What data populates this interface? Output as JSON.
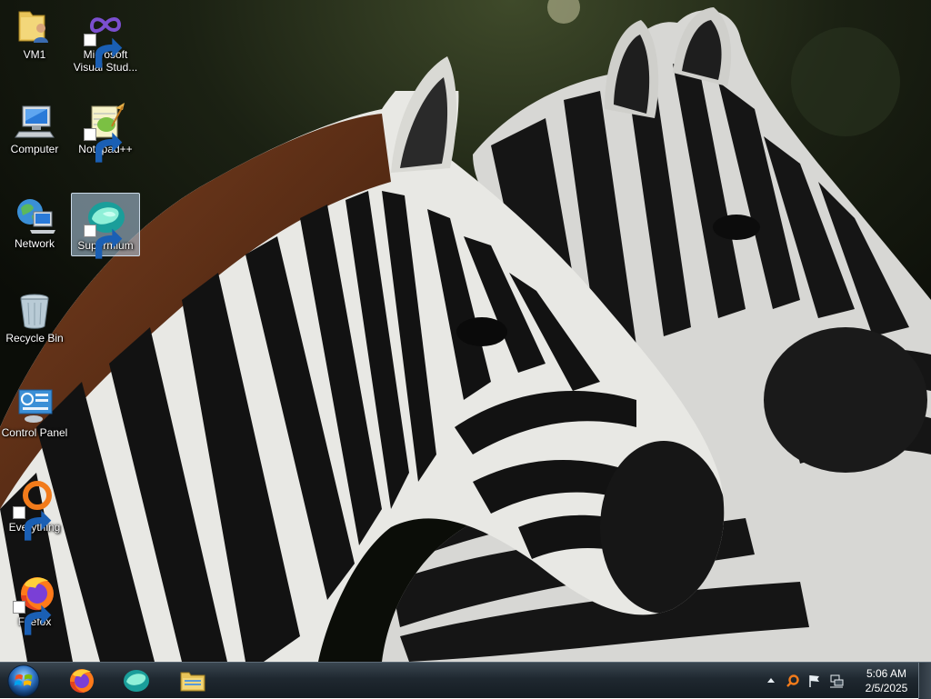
{
  "desktop": {
    "icons": [
      {
        "name": "vm1",
        "label": "VM1"
      },
      {
        "name": "microsoft-visual-studio",
        "label": "Microsoft\nVisual Stud..."
      },
      {
        "name": "computer",
        "label": "Computer"
      },
      {
        "name": "notepad-plus-plus",
        "label": "Notepad++"
      },
      {
        "name": "network",
        "label": "Network"
      },
      {
        "name": "supermium",
        "label": "Supermium"
      },
      {
        "name": "recycle-bin",
        "label": "Recycle Bin"
      },
      {
        "name": "control-panel",
        "label": "Control Panel"
      },
      {
        "name": "everything",
        "label": "Everything"
      },
      {
        "name": "firefox",
        "label": "Firefox"
      }
    ],
    "selected_icon": "Supermium"
  },
  "taskbar": {
    "start_icon": "windows-start-orb-icon",
    "pinned": [
      {
        "name": "firefox",
        "icon": "firefox-icon"
      },
      {
        "name": "supermium",
        "icon": "supermium-icon"
      },
      {
        "name": "file-explorer",
        "icon": "folder-icon"
      }
    ],
    "tray": {
      "icons": [
        "show-hidden-icons-arrow",
        "everything-search-icon",
        "action-center-flag-icon",
        "network-icon"
      ],
      "time": "5:06 AM",
      "date": "2/5/2025"
    }
  },
  "colors": {
    "taskbar": "#1f2830",
    "selection": "#b4d2eb",
    "label_text": "#ffffff"
  }
}
